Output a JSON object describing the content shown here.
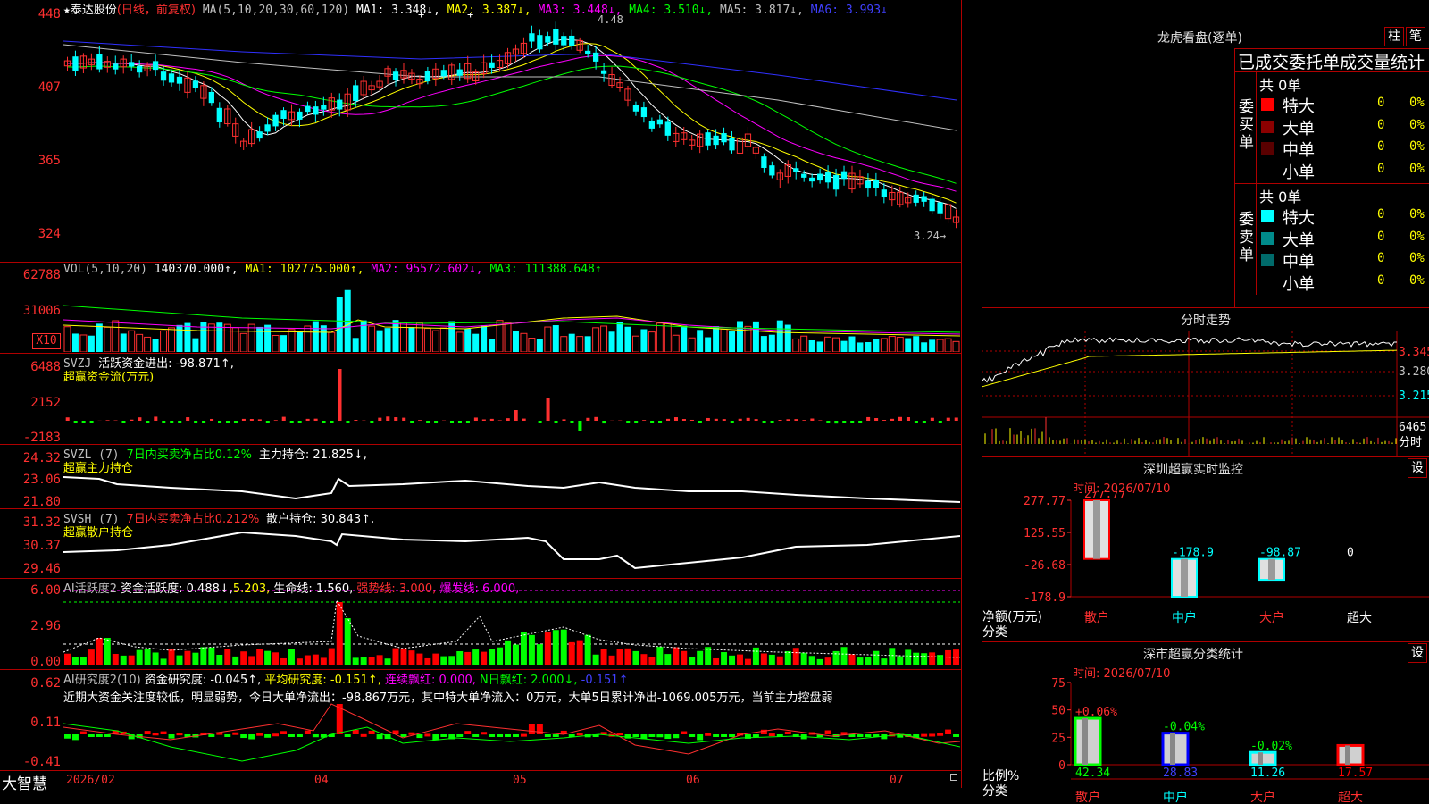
{
  "kline": {
    "header": {
      "star": "★",
      "stock_name": "泰达股份",
      "period": "(日线，前复权)",
      "ma_label": "MA(5,10,20,30,60,120)",
      "ma1": "MA1: 3.348↓,",
      "ma2": "MA2: 3.387↓,",
      "ma3": "MA3: 3.448↓,",
      "ma4": "MA4: 3.510↓,",
      "ma5": "MA5: 3.817↓,",
      "ma6": "MA6: 3.993↓"
    },
    "axis": [
      "448",
      "407",
      "365",
      "324"
    ],
    "high_label": "4.48",
    "low_label": "3.24→",
    "plus_marks": [
      "+",
      "+",
      "+"
    ]
  },
  "volume": {
    "header": {
      "name": "VOL(5,10,20)",
      "v": "140370.000↑,",
      "ma1": "MA1: 102775.000↑,",
      "ma2": "MA2: 95572.602↓,",
      "ma3": "MA3: 111388.648↑"
    },
    "axis": [
      "62788",
      "31006"
    ],
    "unit": "X10"
  },
  "svzj": {
    "header": {
      "name": "SVZJ",
      "text": "活跃资金进出: -98.871↑,",
      "line2": "超赢资金流(万元)"
    },
    "axis": [
      "6488",
      "2152",
      "-2183"
    ]
  },
  "svzl": {
    "header": {
      "name": "SVZL (7)",
      "part1": "7日内买卖净占比0.12%",
      "part2": "主力持仓: 21.825↓,",
      "line2": "超赢主力持仓"
    },
    "axis": [
      "24.32",
      "23.06",
      "21.80"
    ]
  },
  "svsh": {
    "header": {
      "name": "SVSH (7)",
      "part1": "7日内买卖净占比0.212%",
      "part2": "散户持仓: 30.843↑,",
      "line2": "超赢散户持仓"
    },
    "axis": [
      "31.32",
      "30.37",
      "29.46"
    ]
  },
  "ai_active": {
    "header": {
      "name": "AI活跃度2",
      "p1": "资金活跃度: 0.488↓,",
      "p2": "5.203,",
      "p3": "生命线: 1.560,",
      "p4": "强势线: 3.000,",
      "p5": "爆发线: 6.000,"
    },
    "axis": [
      "6.00",
      "2.96",
      "0.00"
    ]
  },
  "ai_research": {
    "header": {
      "name": "AI研究度2(10)",
      "p1": "资金研究度: -0.045↑,",
      "p2": "平均研究度: -0.151↑,",
      "p3": "连续飘红: 0.000,",
      "p4": "N日飘红: 2.000↓,",
      "p5": "-0.151↑"
    },
    "comment": "近期大资金关注度较低，明显弱势，今日大单净流出：-98.867万元，其中特大单净流入：0万元，大单5日累计净出-1069.005万元，当前主力控盘弱",
    "axis": [
      "0.62",
      "0.11",
      "-0.41"
    ]
  },
  "bottom_axis": {
    "brand": "大智慧",
    "dates": [
      "2026/02",
      "04",
      "05",
      "06",
      "07"
    ]
  },
  "longhu": {
    "title": "龙虎看盘(逐单)",
    "btn_bar": "柱",
    "btn_stroke": "笔",
    "subtitle": "已成交委托单成交量统计",
    "buy_side_label": "委买单",
    "sell_side_label": "委卖单",
    "buy_total": "共 0单",
    "sell_total": "共 0单",
    "buy_rows": [
      {
        "label": "特大",
        "count": "0",
        "pct": "0%",
        "color": "#ff0000"
      },
      {
        "label": "大单",
        "count": "0",
        "pct": "0%",
        "color": "#8b0000"
      },
      {
        "label": "中单",
        "count": "0",
        "pct": "0%",
        "color": "#5a0000"
      },
      {
        "label": "小单",
        "count": "0",
        "pct": "0%",
        "color": ""
      }
    ],
    "sell_rows": [
      {
        "label": "特大",
        "count": "0",
        "pct": "0%",
        "color": "#00ffff"
      },
      {
        "label": "大单",
        "count": "0",
        "pct": "0%",
        "color": "#008b8b"
      },
      {
        "label": "中单",
        "count": "0",
        "pct": "0%",
        "color": "#006a6a"
      },
      {
        "label": "小单",
        "count": "0",
        "pct": "0%",
        "color": ""
      }
    ]
  },
  "intraday": {
    "title": "分时走势",
    "axis": [
      "3.345",
      "3.280",
      "3.215"
    ],
    "vol_axis": [
      "6465",
      "分时"
    ]
  },
  "sz_monitor": {
    "title": "深圳超赢实时监控",
    "btn": "设",
    "time": "时间: 2026/07/10",
    "axis": [
      "277.77",
      "125.55",
      "-26.68",
      "-178.9"
    ],
    "unit": "净额(万元)",
    "cat_label": "分类",
    "categories": [
      "散户",
      "中户",
      "大户",
      "超大"
    ],
    "values": [
      277.77,
      -178.9,
      -98.87,
      0
    ],
    "value_labels": [
      "277.77",
      "-178.9",
      "-98.87",
      "0"
    ]
  },
  "sz_class": {
    "title": "深市超赢分类统计",
    "btn": "设",
    "time": "时间: 2026/07/10",
    "axis": [
      "75",
      "50",
      "25",
      "0"
    ],
    "unit": "比例%",
    "cat_label": "分类",
    "categories": [
      "散户",
      "中户",
      "大户",
      "超大"
    ],
    "ratios": [
      42.34,
      28.83,
      11.26,
      17.57
    ],
    "ratio_labels": [
      "42.34",
      "28.83",
      "11.26",
      "17.57"
    ],
    "change_labels": [
      "+0.06%",
      "-0.04%",
      "-0.02%",
      ""
    ],
    "colors": [
      "#00ff00",
      "#0000ff",
      "#00ffff",
      "#ff0000"
    ]
  }
}
